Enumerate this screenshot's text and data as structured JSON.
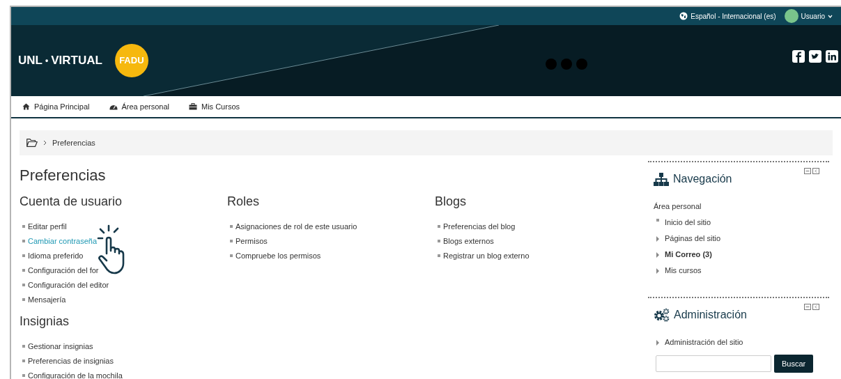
{
  "top_bar": {
    "language": "Español - Internacional (es)",
    "user": "Usuario"
  },
  "header": {
    "logo_left": "UNL",
    "logo_dot": "•",
    "logo_right": "VIRTUAL",
    "badge": "FADU"
  },
  "nav": [
    {
      "label": "Página Principal",
      "kind": "home"
    },
    {
      "label": "Área personal",
      "kind": "dashboard"
    },
    {
      "label": "Mis Cursos",
      "kind": "briefcase"
    }
  ],
  "breadcrumb": [
    "Preferencias"
  ],
  "page_title": "Preferencias",
  "columns": [
    [
      {
        "title": "Cuenta de usuario",
        "links": [
          {
            "label": "Editar perfil",
            "hovered": false
          },
          {
            "label": "Cambiar contraseña",
            "hovered": true
          },
          {
            "label": "Idioma preferido",
            "hovered": false
          },
          {
            "label": "Configuración del for",
            "hovered": false
          },
          {
            "label": "Configuración del editor",
            "hovered": false
          },
          {
            "label": "Mensajería",
            "hovered": false
          }
        ]
      },
      {
        "title": "Insignias",
        "links": [
          {
            "label": "Gestionar insignias",
            "hovered": false
          },
          {
            "label": "Preferencias de insignias",
            "hovered": false
          },
          {
            "label": "Configuración de la mochila",
            "hovered": false
          }
        ]
      }
    ],
    [
      {
        "title": "Roles",
        "links": [
          {
            "label": "Asignaciones de rol de este usuario",
            "hovered": false
          },
          {
            "label": "Permisos",
            "hovered": false
          },
          {
            "label": "Compruebe los permisos",
            "hovered": false
          }
        ]
      }
    ],
    [
      {
        "title": "Blogs",
        "links": [
          {
            "label": "Preferencias del blog",
            "hovered": false
          },
          {
            "label": "Blogs externos",
            "hovered": false
          },
          {
            "label": "Registrar un blog externo",
            "hovered": false
          }
        ]
      }
    ]
  ],
  "blocks": [
    {
      "title": "Navegación",
      "kind": "navigation",
      "items": [
        {
          "label": "Área personal",
          "kind": "heading",
          "bold": false
        },
        {
          "label": "Inicio del sitio",
          "kind": "leaf",
          "bold": false
        },
        {
          "label": "Páginas del sitio",
          "kind": "branch",
          "bold": false
        },
        {
          "label": "Mi Correo (3)",
          "kind": "branch",
          "bold": true
        },
        {
          "label": "Mis cursos",
          "kind": "branch",
          "bold": false
        }
      ]
    },
    {
      "title": "Administración",
      "kind": "settings",
      "items": [
        {
          "label": "Administración del sitio",
          "kind": "branch",
          "bold": false
        }
      ],
      "search_button": "Buscar"
    }
  ]
}
